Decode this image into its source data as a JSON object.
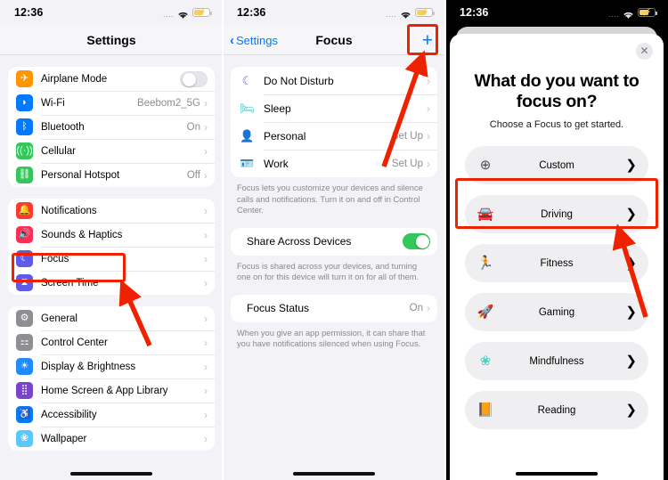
{
  "status_bar": {
    "time": "12:36",
    "signal": "....",
    "wifi_icon": "wifi-icon",
    "battery_icon": "battery-charging-icon",
    "bolt": "⚡"
  },
  "panel_settings": {
    "title": "Settings",
    "groups": [
      {
        "rows": [
          {
            "label": "Airplane Mode",
            "icon": "airplane-icon",
            "glyph": "✈",
            "cls": "g-plane",
            "control": "toggle-off"
          },
          {
            "label": "Wi-Fi",
            "icon": "wifi-icon",
            "glyph": "◗",
            "cls": "g-wifi",
            "value": "Beebom2_5G",
            "control": "chevron"
          },
          {
            "label": "Bluetooth",
            "icon": "bluetooth-icon",
            "glyph": "ᛒ",
            "cls": "g-bt",
            "value": "On",
            "control": "chevron"
          },
          {
            "label": "Cellular",
            "icon": "cellular-icon",
            "glyph": "((·))",
            "cls": "g-cell",
            "value": "",
            "control": "chevron"
          },
          {
            "label": "Personal Hotspot",
            "icon": "hotspot-icon",
            "glyph": "⛓",
            "cls": "g-hot",
            "value": "Off",
            "control": "chevron"
          }
        ]
      },
      {
        "rows": [
          {
            "label": "Notifications",
            "icon": "bell-icon",
            "glyph": "🔔",
            "cls": "g-notif",
            "value": "",
            "control": "chevron"
          },
          {
            "label": "Sounds & Haptics",
            "icon": "speaker-icon",
            "glyph": "🔊",
            "cls": "g-sound",
            "value": "",
            "control": "chevron"
          },
          {
            "label": "Focus",
            "icon": "moon-icon",
            "glyph": "☾",
            "cls": "g-focus",
            "value": "",
            "control": "chevron"
          },
          {
            "label": "Screen Time",
            "icon": "hourglass-icon",
            "glyph": "⧗",
            "cls": "g-screen",
            "value": "",
            "control": "chevron"
          }
        ]
      },
      {
        "rows": [
          {
            "label": "General",
            "icon": "gear-icon",
            "glyph": "⚙",
            "cls": "g-gen",
            "value": "",
            "control": "chevron"
          },
          {
            "label": "Control Center",
            "icon": "sliders-icon",
            "glyph": "⚏",
            "cls": "g-cc",
            "value": "",
            "control": "chevron"
          },
          {
            "label": "Display & Brightness",
            "icon": "brightness-icon",
            "glyph": "☀",
            "cls": "g-disp",
            "value": "",
            "control": "chevron"
          },
          {
            "label": "Home Screen & App Library",
            "icon": "app-grid-icon",
            "glyph": "⣿",
            "cls": "g-home",
            "value": "",
            "control": "chevron"
          },
          {
            "label": "Accessibility",
            "icon": "accessibility-icon",
            "glyph": "♿",
            "cls": "g-acc",
            "value": "",
            "control": "chevron"
          },
          {
            "label": "Wallpaper",
            "icon": "flower-icon",
            "glyph": "❀",
            "cls": "g-wall",
            "value": "",
            "control": "chevron"
          }
        ]
      }
    ]
  },
  "panel_focus": {
    "back_label": "Settings",
    "title": "Focus",
    "add_button": "+",
    "modes": [
      {
        "label": "Do Not Disturb",
        "icon": "moon-icon",
        "glyph": "☾",
        "color": "#5e5ce6",
        "value": ""
      },
      {
        "label": "Sleep",
        "icon": "bed-icon",
        "glyph": "🛏",
        "color": "#2ec4c4",
        "value": ""
      },
      {
        "label": "Personal",
        "icon": "person-icon",
        "glyph": "👤",
        "color": "#b452e6",
        "value": "Set Up"
      },
      {
        "label": "Work",
        "icon": "badge-icon",
        "glyph": "🪪",
        "color": "#2ec4c4",
        "value": "Set Up"
      }
    ],
    "modes_footnote": "Focus lets you customize your devices and silence calls and notifications. Turn it on and off in Control Center.",
    "share_label": "Share Across Devices",
    "share_toggle": "on",
    "share_footnote": "Focus is shared across your devices, and turning one on for this device will turn it on for all of them.",
    "status_label": "Focus Status",
    "status_value": "On",
    "status_footnote": "When you give an app permission, it can share that you have notifications silenced when using Focus."
  },
  "panel_sheet": {
    "close_icon": "close-icon",
    "heading": "What do you want to focus on?",
    "subheading": "Choose a Focus to get started.",
    "options": [
      {
        "label": "Custom",
        "icon": "plus-circle-icon",
        "glyph": "⊕",
        "color": "#4a4a4f"
      },
      {
        "label": "Driving",
        "icon": "car-icon",
        "glyph": "🚘",
        "color": "#5e5ce6"
      },
      {
        "label": "Fitness",
        "icon": "running-icon",
        "glyph": "🏃",
        "color": "#34c759"
      },
      {
        "label": "Gaming",
        "icon": "rocket-icon",
        "glyph": "🚀",
        "color": "#007aff"
      },
      {
        "label": "Mindfulness",
        "icon": "flower-icon",
        "glyph": "❀",
        "color": "#4ecdc4"
      },
      {
        "label": "Reading",
        "icon": "book-icon",
        "glyph": "📙",
        "color": "#ff9500"
      }
    ]
  },
  "annotations": {
    "accent_color": "#ee2200",
    "highlights": [
      {
        "name": "focus-row-highlight"
      },
      {
        "name": "add-focus-button-highlight"
      },
      {
        "name": "custom-option-highlight"
      }
    ],
    "arrows": [
      {
        "name": "arrow-to-focus-row"
      },
      {
        "name": "arrow-to-add-button"
      },
      {
        "name": "arrow-to-custom-option"
      }
    ]
  }
}
